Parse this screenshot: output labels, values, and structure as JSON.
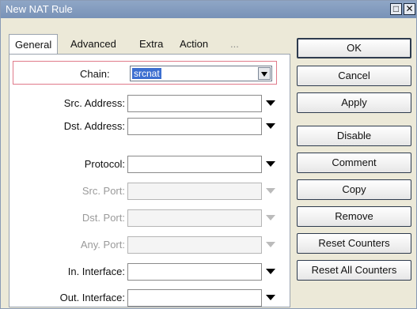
{
  "window": {
    "title": "New NAT Rule"
  },
  "titlebar_buttons": {
    "restore": "□",
    "close": "✕"
  },
  "tabs": [
    "General",
    "Advanced",
    "Extra",
    "Action",
    "..."
  ],
  "chain": {
    "label": "Chain:",
    "value": "srcnat"
  },
  "fields": [
    {
      "label": "Src. Address:",
      "enabled": true
    },
    {
      "label": "Dst. Address:",
      "enabled": true
    },
    {
      "label": "Protocol:",
      "enabled": true
    },
    {
      "label": "Src. Port:",
      "enabled": false
    },
    {
      "label": "Dst. Port:",
      "enabled": false
    },
    {
      "label": "Any. Port:",
      "enabled": false
    },
    {
      "label": "In. Interface:",
      "enabled": true
    },
    {
      "label": "Out. Interface:",
      "enabled": true
    }
  ],
  "buttons": [
    "OK",
    "Cancel",
    "Apply",
    "Disable",
    "Comment",
    "Copy",
    "Remove",
    "Reset Counters",
    "Reset All Counters"
  ]
}
